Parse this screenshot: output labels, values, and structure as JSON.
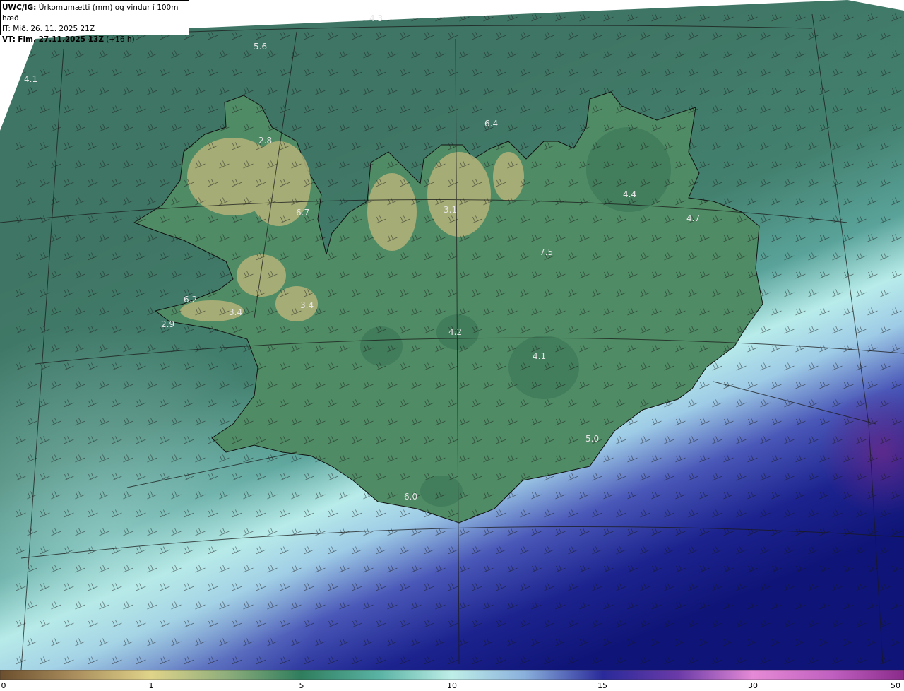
{
  "header": {
    "model": "UWC/IG:",
    "description": "Úrkomumætti (mm) og vindur í 100m hæð",
    "init_prefix": "IT:",
    "init_time": "Mið. 26. 11. 2025 21Z",
    "valid_prefix": "VT:",
    "valid_time": "Fim. 27.11.2025 13Z",
    "lead": "(+16 h)"
  },
  "map_labels": [
    {
      "id": "label-1",
      "text": "4.3"
    },
    {
      "id": "label-2",
      "text": "5.6"
    },
    {
      "id": "label-3",
      "text": "4.1"
    },
    {
      "id": "label-4",
      "text": "2.8"
    },
    {
      "id": "label-5",
      "text": "6.4"
    },
    {
      "id": "label-6",
      "text": "4.4"
    },
    {
      "id": "label-7",
      "text": "6.7"
    },
    {
      "id": "label-8",
      "text": "3.1"
    },
    {
      "id": "label-9",
      "text": "4.7"
    },
    {
      "id": "label-10",
      "text": "7.5"
    },
    {
      "id": "label-11",
      "text": "6.2"
    },
    {
      "id": "label-12",
      "text": "3.4"
    },
    {
      "id": "label-13",
      "text": "3.4"
    },
    {
      "id": "label-14",
      "text": "2.9"
    },
    {
      "id": "label-15",
      "text": "4.2"
    },
    {
      "id": "label-16",
      "text": "4.1"
    },
    {
      "id": "label-17",
      "text": "5.0"
    },
    {
      "id": "label-18",
      "text": "6.0"
    }
  ],
  "colorbar": {
    "ticks": [
      "0",
      "1",
      "5",
      "10",
      "15",
      "30",
      "50"
    ],
    "colors": [
      "#6b4f2e",
      "#e0d48a",
      "#2f7d5e",
      "#bfeee8",
      "#2a2a9a",
      "#e58ad6",
      "#8a2a8a"
    ]
  },
  "colors": {
    "ocean_far": "#3f7564",
    "ocean_mid": "#4a8e7f",
    "wet_band": "#b8ecea",
    "heavy_band": "#1a1f86",
    "land": "#4f8760",
    "high_terrain": "#b9b67c",
    "coast": "#111111"
  }
}
